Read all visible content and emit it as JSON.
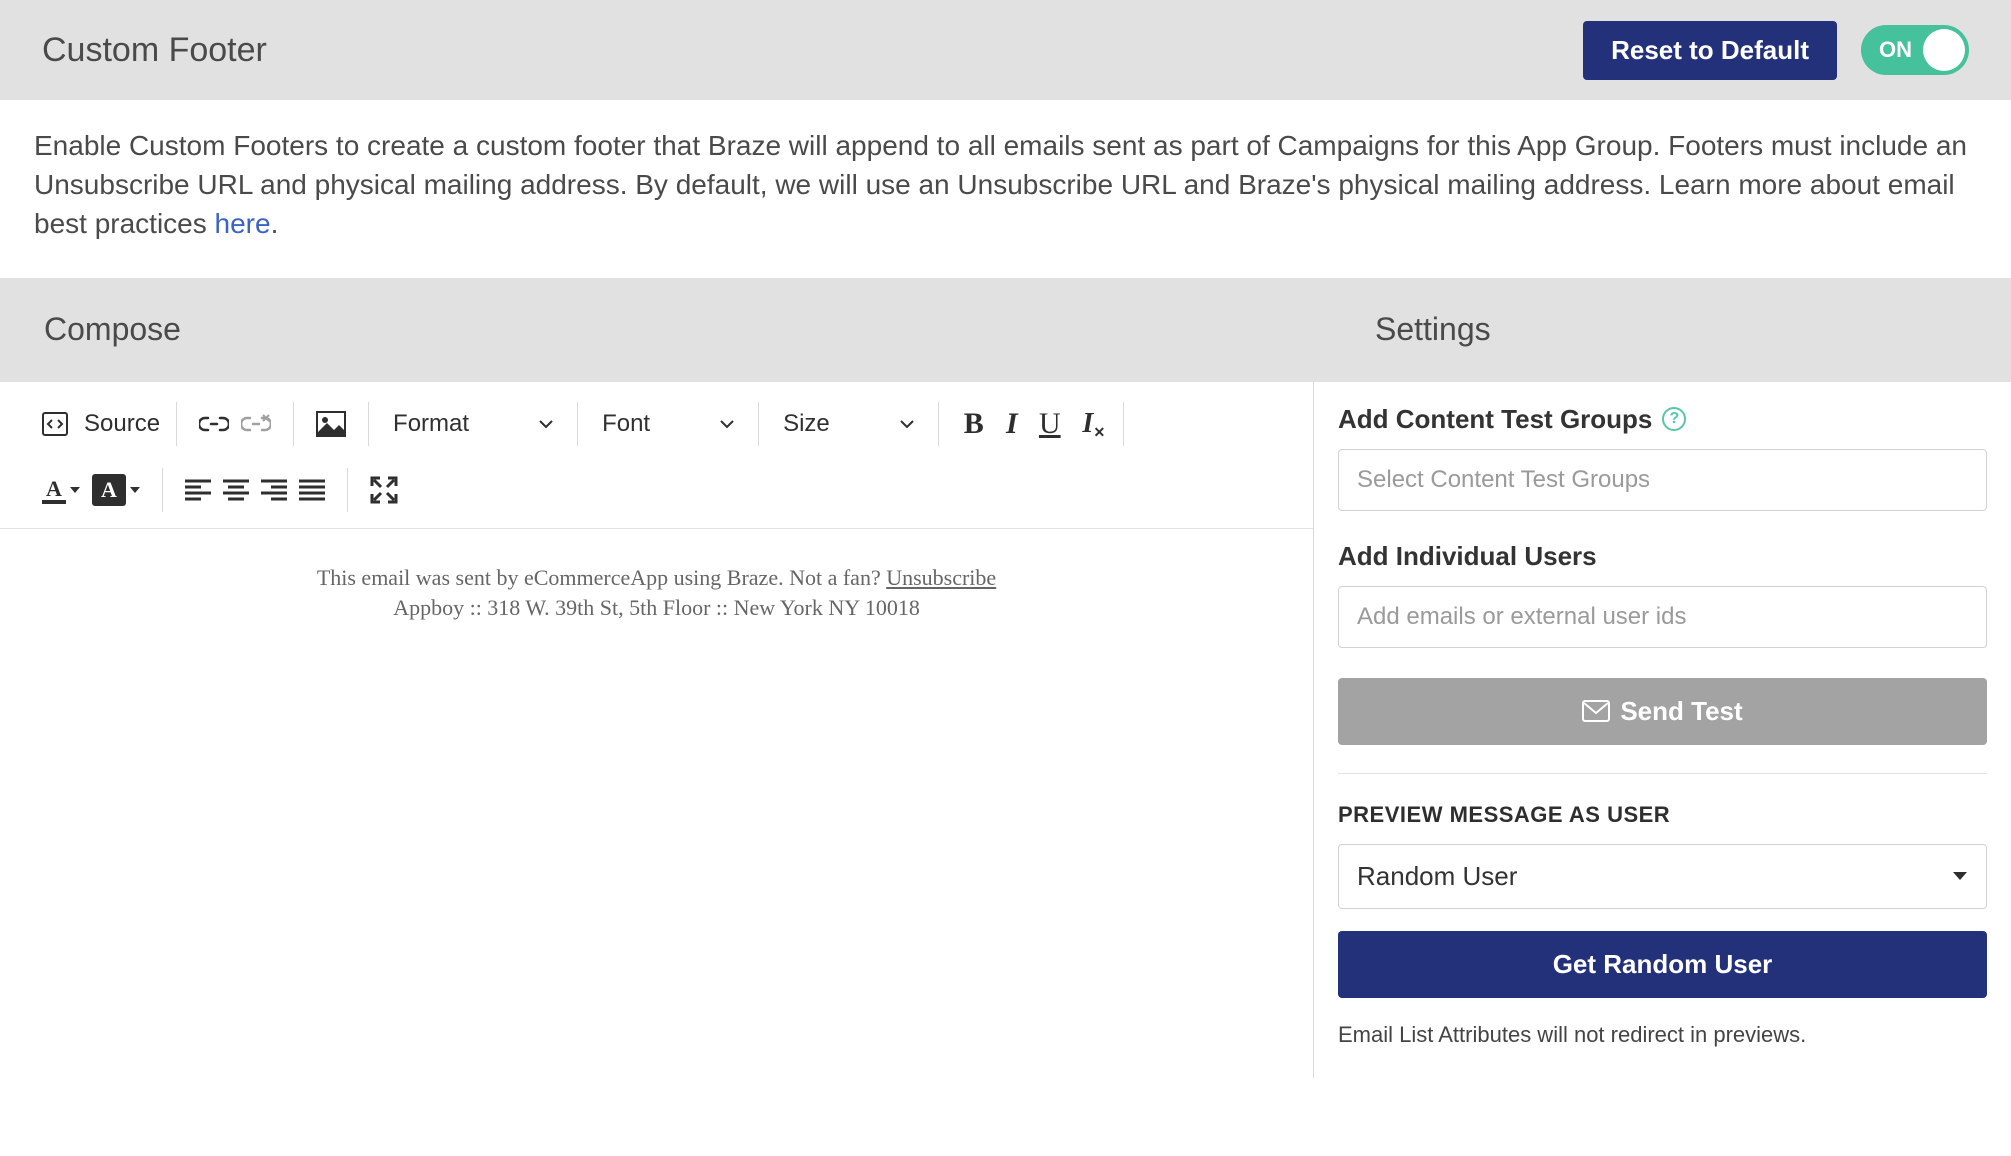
{
  "header": {
    "title": "Custom Footer",
    "reset_button": "Reset to Default",
    "toggle_state": "ON"
  },
  "description": {
    "text_before_link": "Enable Custom Footers to create a custom footer that Braze will append to all emails sent as part of Campaigns for this App Group. Footers must include an Unsubscribe URL and physical mailing address. By default, we will use an Unsubscribe URL and Braze's physical mailing address. Learn more about email best practices ",
    "link_text": "here",
    "after_link": "."
  },
  "sections": {
    "compose": "Compose",
    "settings": "Settings"
  },
  "toolbar": {
    "source_label": "Source",
    "format_label": "Format",
    "font_label": "Font",
    "size_label": "Size"
  },
  "footer_preview": {
    "line1_before": "This email was sent by eCommerceApp using Braze. Not a fan? ",
    "unsubscribe": "Unsubscribe",
    "line2": "Appboy :: 318 W. 39th St, 5th Floor :: New York NY 10018"
  },
  "settings_pane": {
    "content_test_label": "Add Content Test Groups",
    "content_test_placeholder": "Select Content Test Groups",
    "individual_users_label": "Add Individual Users",
    "individual_users_placeholder": "Add emails or external user ids",
    "send_test_button": "Send Test",
    "preview_heading": "PREVIEW MESSAGE AS USER",
    "preview_select_value": "Random User",
    "get_random_button": "Get Random User",
    "note": "Email List Attributes will not redirect in previews."
  }
}
